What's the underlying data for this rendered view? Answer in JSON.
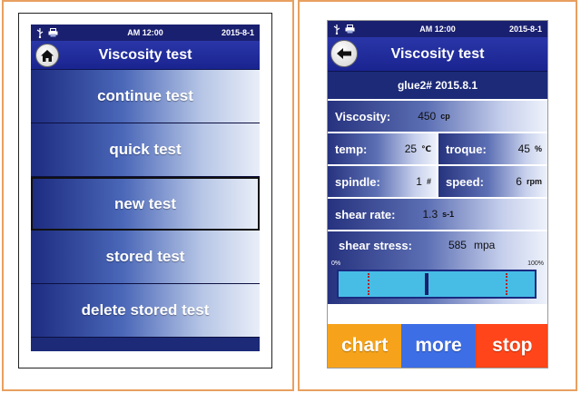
{
  "status": {
    "time": "AM 12:00",
    "date": "2015-8-1"
  },
  "menu_screen": {
    "title": "Viscosity test",
    "items": [
      {
        "label": "continue test"
      },
      {
        "label": "quick test"
      },
      {
        "label": "new test"
      },
      {
        "label": "stored test"
      },
      {
        "label": "delete stored test"
      }
    ]
  },
  "test_screen": {
    "title": "Viscosity test",
    "test_name": "glue2# 2015.8.1",
    "viscosity": {
      "label": "Viscosity:",
      "value": "450",
      "unit": "cp"
    },
    "temp": {
      "label": "temp:",
      "value": "25",
      "unit": "℃"
    },
    "troque": {
      "label": "troque:",
      "value": "45",
      "unit": "%"
    },
    "spindle": {
      "label": "spindle:",
      "value": "1",
      "unit": "#"
    },
    "speed": {
      "label": "speed:",
      "value": "6",
      "unit": "rpm"
    },
    "shear_rate": {
      "label": "shear rate:",
      "value": "1.3",
      "unit": "s-1"
    },
    "shear_stress": {
      "label": "shear stress:",
      "value": "585",
      "unit": "mpa"
    },
    "gauge": {
      "min_label": "0%",
      "max_label": "100%",
      "level": 0.45,
      "low_mark": 0.15,
      "high_mark": 0.85
    },
    "buttons": {
      "chart": "chart",
      "more": "more",
      "stop": "stop"
    }
  },
  "colors": {
    "chart": "#f6a31b",
    "more": "#3d6ee6",
    "stop": "#ff4519",
    "header": "#1c2a78",
    "gauge": "#47bde6"
  }
}
